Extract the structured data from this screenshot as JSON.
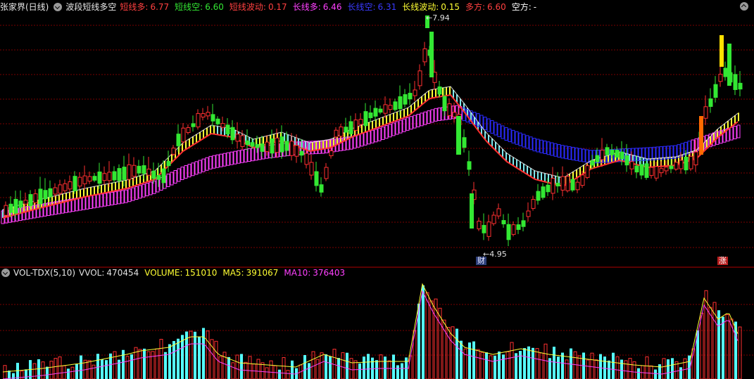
{
  "main_header": {
    "stock": "张家界(日线)",
    "indicator": "波段短线多空",
    "items": [
      {
        "label": "短线多:",
        "value": "6.77",
        "color": "#ff4040"
      },
      {
        "label": "短线空:",
        "value": "6.60",
        "color": "#33e833"
      },
      {
        "label": "短线波动:",
        "value": "0.17",
        "color": "#ff4040"
      },
      {
        "label": "长线多:",
        "value": "6.46",
        "color": "#ff40ff"
      },
      {
        "label": "长线空:",
        "value": "6.31",
        "color": "#3a3aff"
      },
      {
        "label": "长线波动:",
        "value": "0.15",
        "color": "#ffff33"
      },
      {
        "label": "多方:",
        "value": "6.60",
        "color": "#ff4040"
      },
      {
        "label": "空方:",
        "value": "-",
        "color": "#ffffff"
      }
    ]
  },
  "price_annotations": {
    "high": "7.94",
    "low": "4.95"
  },
  "markers": {
    "finance": "财",
    "limit_up": "涨"
  },
  "vol_header": {
    "name": "VOL-TDX(5,10)",
    "items": [
      {
        "label": "VVOL:",
        "value": "470454",
        "color": "#e0e0e0"
      },
      {
        "label": "VOLUME:",
        "value": "151010",
        "color": "#ffff33"
      },
      {
        "label": "MA5:",
        "value": "391067",
        "color": "#ffff33"
      },
      {
        "label": "MA10:",
        "value": "376403",
        "color": "#ff40ff"
      }
    ]
  },
  "colors": {
    "up": "#ff3030",
    "down": "#33e833",
    "short_band_up": "#ffff33",
    "short_band_down": "#7ee8ee",
    "long_band_up": "#ff40ff",
    "long_band_down": "#2a2aff",
    "grid": "#7a0000",
    "separator": "#b00000",
    "vol_up": "#ff3030",
    "vol_down": "#55ffff"
  }
}
